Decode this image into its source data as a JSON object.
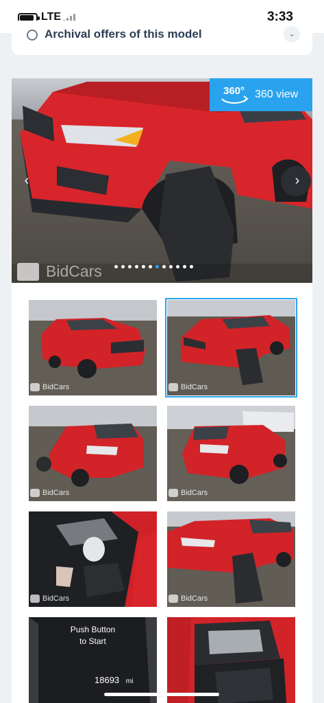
{
  "status_bar": {
    "carrier": "LTE",
    "time": "3:33",
    "battery_level": 0.85
  },
  "archival": {
    "label": "Archival offers of this model"
  },
  "gallery": {
    "view_360_badge": "360°",
    "view_360_label": "360 view",
    "watermark": "BidCars",
    "active_slide": 7,
    "slide_count": 12,
    "thumbnails": [
      {
        "watermark": "BidCars",
        "selected": false
      },
      {
        "watermark": "BidCars",
        "selected": true
      },
      {
        "watermark": "BidCars",
        "selected": false
      },
      {
        "watermark": "BidCars",
        "selected": false
      },
      {
        "watermark": "BidCars",
        "selected": false
      },
      {
        "watermark": "BidCars",
        "selected": false
      },
      {
        "watermark": "",
        "selected": false,
        "dash_text_1": "Push Button",
        "dash_text_2": "to Start",
        "odometer": "18693",
        "odometer_unit": "mi"
      },
      {
        "watermark": "",
        "selected": false
      }
    ]
  },
  "colors": {
    "accent": "#2aa3ee",
    "car_red": "#d8252b",
    "panel": "#ffffff",
    "page_bg": "#eef1f4"
  }
}
